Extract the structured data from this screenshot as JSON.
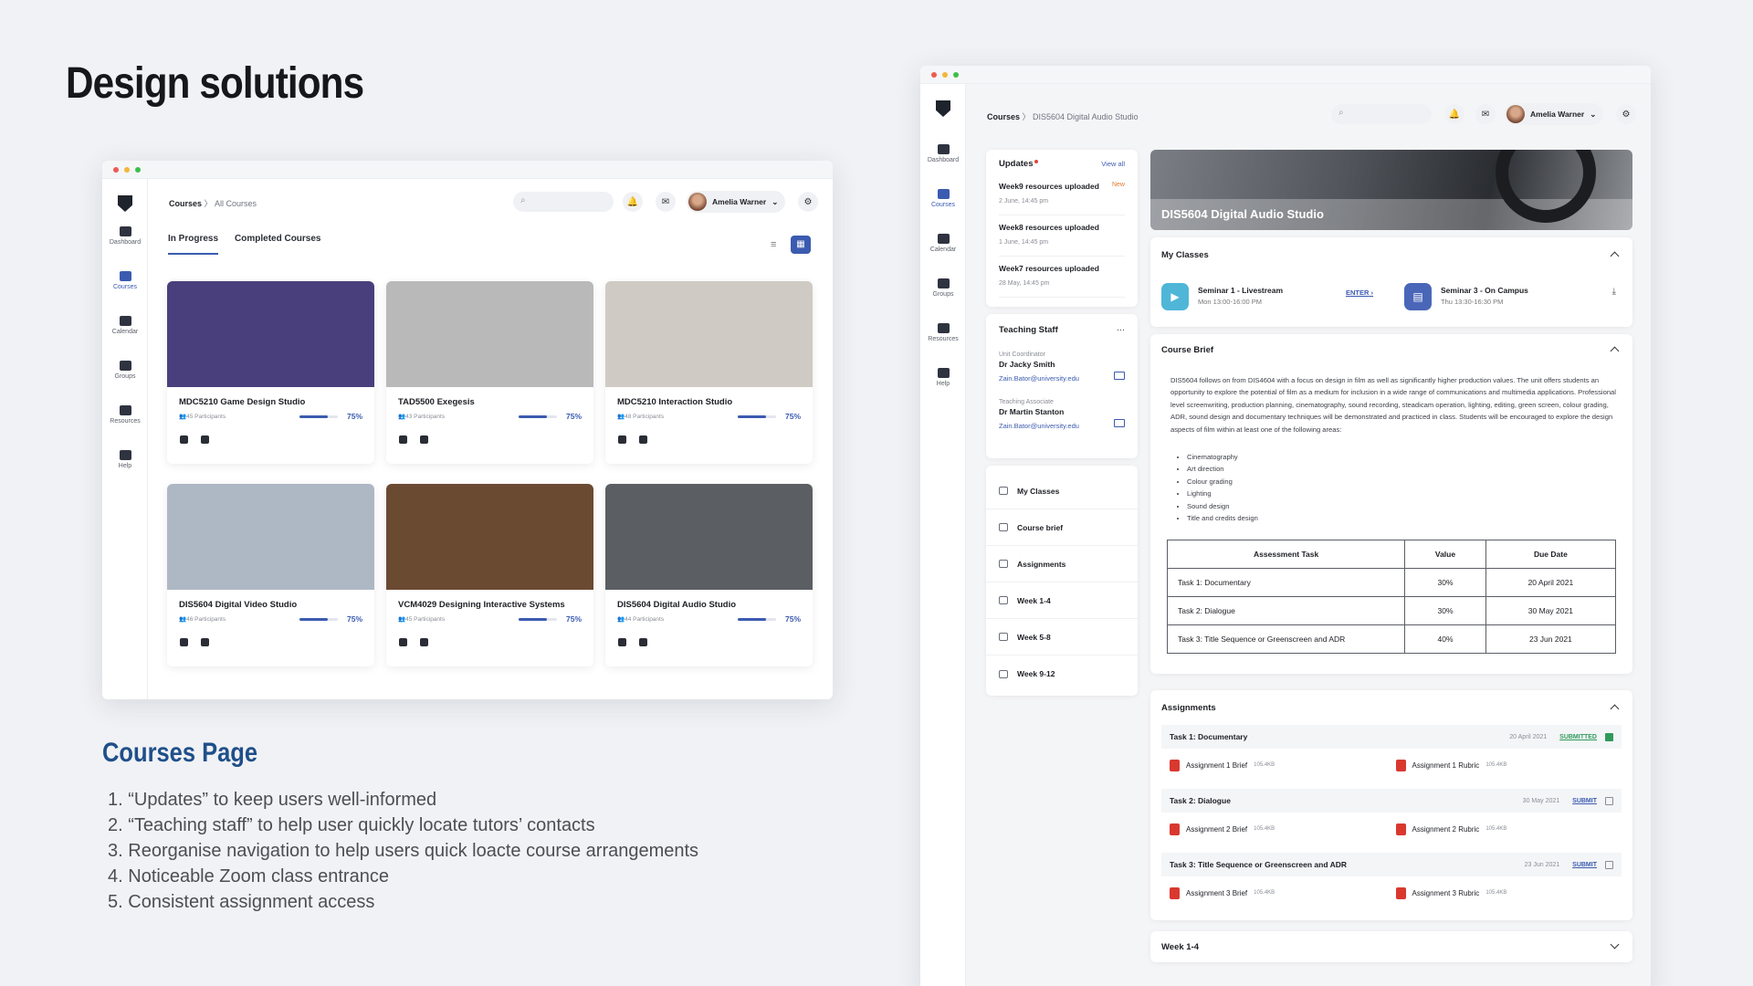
{
  "title": "Design solutions",
  "subtitle": "Courses Page",
  "notes": [
    "“Updates” to keep users well-informed",
    "“Teaching staff” to help user quickly locate tutors’ contacts",
    "Reorganise navigation to help users quick loacte course arrangements",
    "Noticeable Zoom class entrance",
    "Consistent assignment access"
  ],
  "nav": [
    "Dashboard",
    "Courses",
    "Calendar",
    "Groups",
    "Resources",
    "Help"
  ],
  "user": "Amelia Warner",
  "left": {
    "breadcrumb": {
      "root": "Courses",
      "current": "All Courses"
    },
    "tabs": [
      "In Progress",
      "Completed Courses"
    ],
    "courses": [
      {
        "title": "MDC5210 Game Design Studio",
        "participants": "45 Participants",
        "progress": 0.75,
        "pct": "75%",
        "img": "#4a3f7d"
      },
      {
        "title": "TAD5500 Exegesis",
        "participants": "43 Participants",
        "progress": 0.75,
        "pct": "75%",
        "img": "#b9b9b9"
      },
      {
        "title": "MDC5210  Interaction Studio",
        "participants": "48 Participants",
        "progress": 0.75,
        "pct": "75%",
        "img": "#cfcac3"
      },
      {
        "title": "DIS5604 Digital Video Studio",
        "participants": "46 Participants",
        "progress": 0.75,
        "pct": "75%",
        "img": "#aeb8c4"
      },
      {
        "title": "VCM4029 Designing Interactive Systems",
        "participants": "45 Participants",
        "progress": 0.75,
        "pct": "75%",
        "img": "#6b4a32"
      },
      {
        "title": "DIS5604 Digital Audio Studio",
        "participants": "44 Participants",
        "progress": 0.75,
        "pct": "75%",
        "img": "#5b5e63"
      }
    ]
  },
  "right": {
    "breadcrumb": {
      "root": "Courses",
      "current": "DIS5604 Digital Audio Studio"
    },
    "updates": {
      "title": "Updates",
      "view_all": "View all",
      "items": [
        {
          "text": "Week9 resources uploaded",
          "date": "2 June, 14:45 pm",
          "badge": "New"
        },
        {
          "text": "Week8 resources uploaded",
          "date": "1 June, 14:45 pm",
          "badge": ""
        },
        {
          "text": "Week7 resources uploaded",
          "date": "28 May, 14:45 pm",
          "badge": ""
        }
      ]
    },
    "staff": {
      "title": "Teaching Staff",
      "more": "···",
      "people": [
        {
          "role": "Unit Coordinator",
          "name": "Dr Jacky Smith",
          "email": "Zain.Bator@university.edu"
        },
        {
          "role": "Teaching Associate",
          "name": "Dr Martin Stanton",
          "email": "Zain.Bator@university.edu"
        }
      ]
    },
    "menu": [
      "My Classes",
      "Course brief",
      "Assignments",
      "Week 1-4",
      "Week 5-8",
      "Week 9-12"
    ],
    "hero_title": "DIS5604 Digital Audio Studio",
    "classes": {
      "title": "My Classes",
      "items": [
        {
          "name": "Seminar 1 - Livestream",
          "time": "Mon 13:00-16:00 PM",
          "action": "ENTER",
          "color": "#4fb6d8"
        },
        {
          "name": "Seminar 3 - On Campus",
          "time": "Thu 13:30-16:30 PM",
          "action": "",
          "color": "#4a66b8"
        }
      ]
    },
    "brief": {
      "title": "Course Brief",
      "text": "DIS5604 follows on from DIS4604 with a focus on design in film as well as significantly higher production values. The unit offers students an opportunity to explore the potential of film as a medium for inclusion in a wide range of communications and multimedia applications. Professional level screenwriting, production planning, cinematography, sound recording, steadicam operation, lighting, editing, green screen, colour grading, ADR, sound design and documentary techniques will be demonstrated and practiced in class. Students will be encouraged to explore the design aspects of film within at least one of the following areas:",
      "areas": [
        "Cinematography",
        "Art direction",
        "Colour grading",
        "Lighting",
        "Sound design",
        "Title and credits design"
      ],
      "table_head": [
        "Assessment Task",
        "Value",
        "Due Date"
      ],
      "rows": [
        [
          "Task 1: Documentary",
          "30%",
          "20 April 2021"
        ],
        [
          "Task 2: Dialogue",
          "30%",
          "30 May 2021"
        ],
        [
          "Task 3: Title Sequence or Greenscreen and ADR",
          "40%",
          "23 Jun 2021"
        ]
      ]
    },
    "assignments": {
      "title": "Assignments",
      "items": [
        {
          "task": "Task 1: Documentary",
          "date": "20 April 2021",
          "status": "SUBMITTED",
          "status_color": "#2f9a5b",
          "checked": true,
          "brief": "Assignment 1 Brief",
          "rubric": "Assignment 1 Rubric",
          "size": "105.4KB"
        },
        {
          "task": "Task 2: Dialogue",
          "date": "30 May 2021",
          "status": "SUBMIT",
          "status_color": "#3b5bb0",
          "checked": false,
          "brief": "Assignment 2 Brief",
          "rubric": "Assignment 2 Rubric",
          "size": "105.4KB"
        },
        {
          "task": "Task 3: Title Sequence or Greenscreen and ADR",
          "date": "23 Jun 2021",
          "status": "SUBMIT",
          "status_color": "#3b5bb0",
          "checked": false,
          "brief": "Assignment 3 Brief",
          "rubric": "Assignment 3 Rubric",
          "size": "105.4KB"
        }
      ]
    },
    "week_section": "Week 1-4"
  }
}
